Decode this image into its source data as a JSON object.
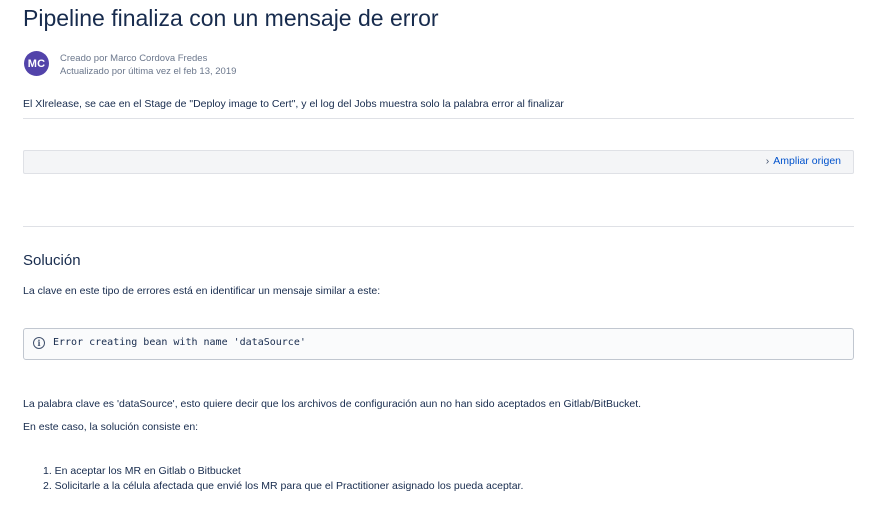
{
  "page": {
    "title": "Pipeline finaliza con un mensaje de error",
    "author": {
      "initials": "MC",
      "created": "Creado por Marco Cordova Fredes",
      "updated": "Actualizado por última vez el feb 13, 2019"
    },
    "description": "El Xlrelease, se cae en el Stage de \"Deploy image to Cert\", y el log del Jobs muestra solo la palabra error al finalizar",
    "expand_source_label": "Ampliar origen",
    "solution": {
      "heading": "Solución",
      "intro": "La clave en este tipo de errores está en identificar un mensaje similar a este:",
      "code": "Error creating bean with name 'dataSource'",
      "explanation": "La palabra clave es 'dataSource', esto quiere decir que los archivos de configuración aun no han sido aceptados en Gitlab/BitBucket.",
      "case_intro": "En este caso, la solución consiste en:",
      "steps": [
        "1. En aceptar los MR en Gitlab o Bitbucket",
        "2. Solicitarle a la célula afectada que envié los MR para que el Practitioner asignado los pueda aceptar."
      ]
    }
  },
  "icons": {
    "expand": "chevron-right-icon",
    "info": "info-icon"
  },
  "colors": {
    "avatar_bg": "#5243aa",
    "link": "#0052cc",
    "text": "#172b4d",
    "muted": "#6b778c"
  }
}
